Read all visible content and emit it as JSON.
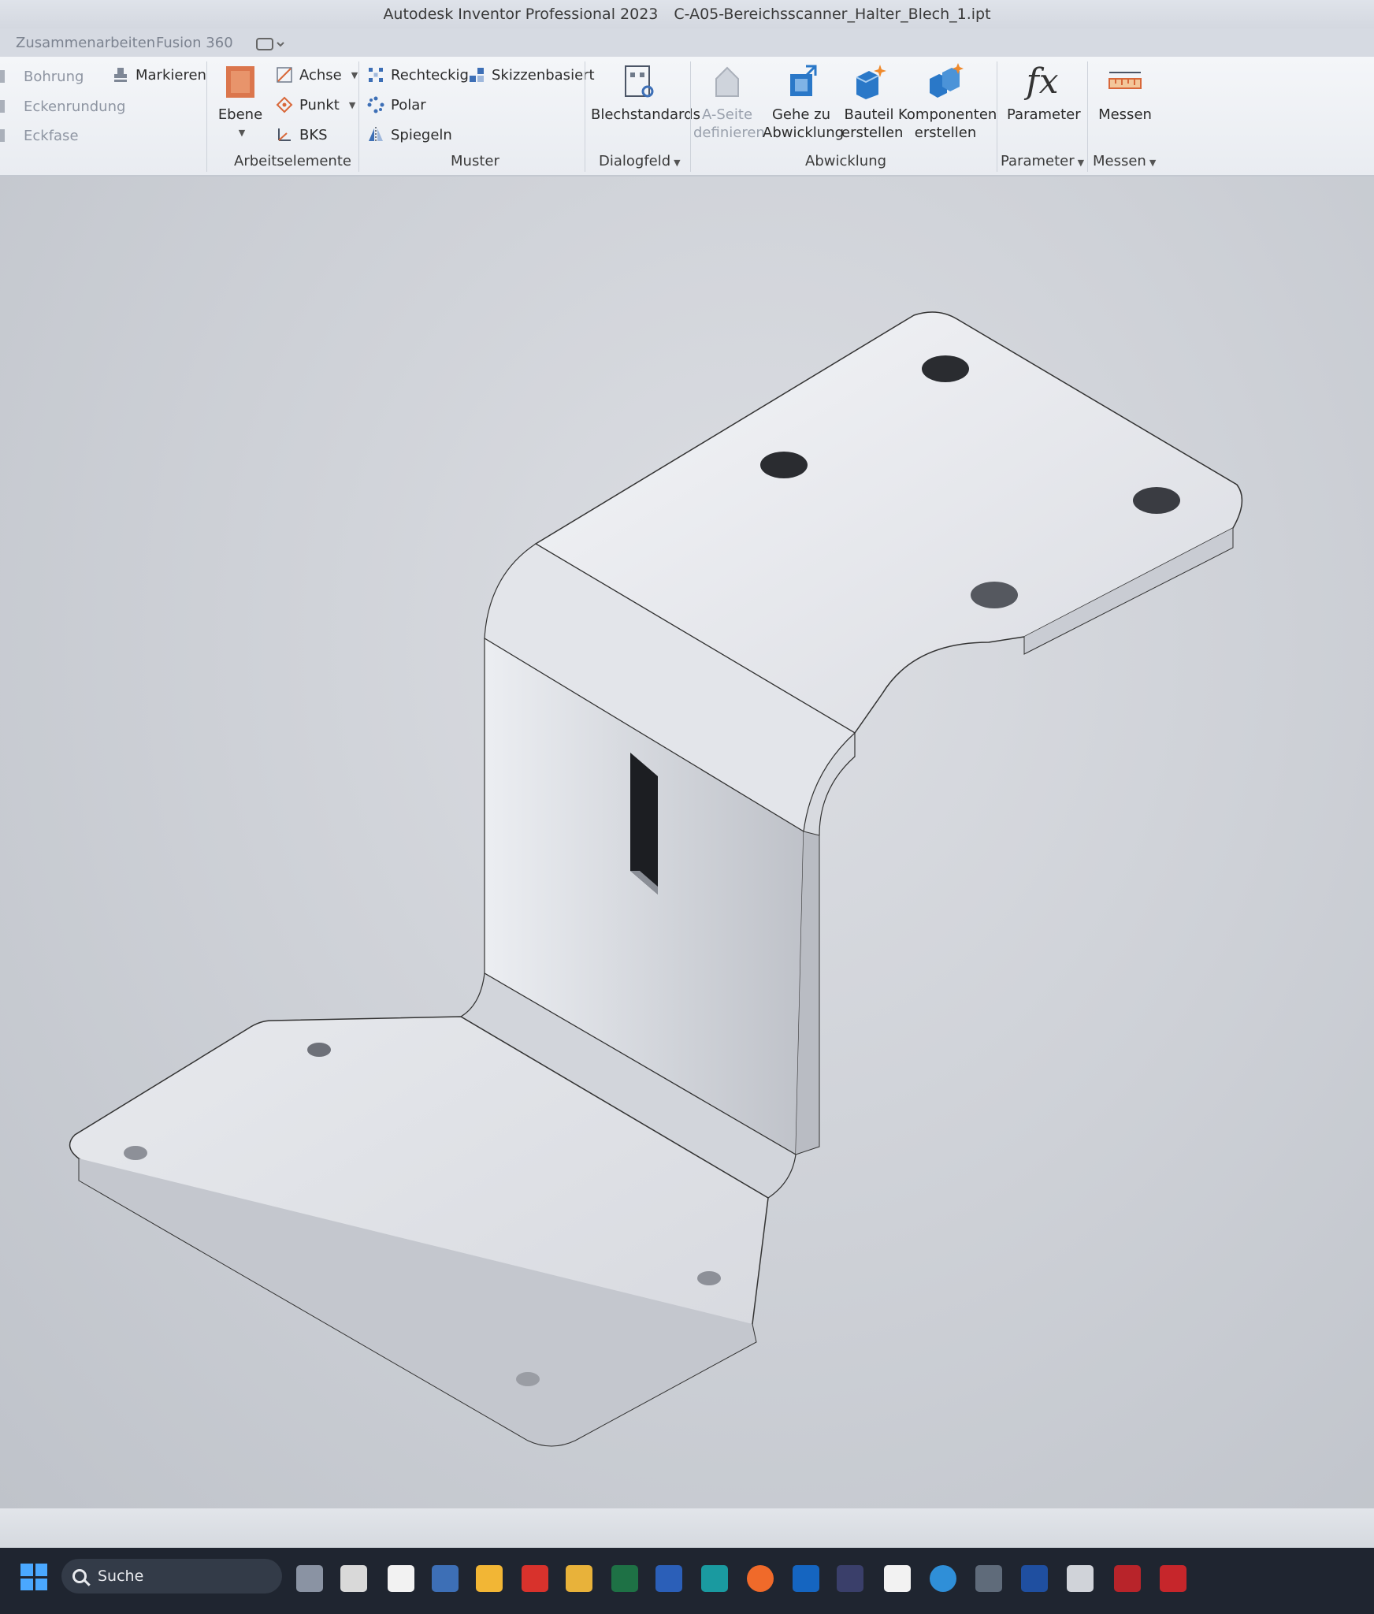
{
  "window": {
    "title_app": "Autodesk Inventor Professional 2023",
    "title_file": "C-A05-Bereichsscanner_Halter_Blech_1.ipt"
  },
  "tabs": [
    {
      "label": "Zusammenarbeiten"
    },
    {
      "label": "Fusion 360"
    }
  ],
  "ribbon": {
    "modify": {
      "bohrung": "Bohrung",
      "eckenrundung": "Eckenrundung",
      "eckfase": "Eckfase",
      "markieren": "Markieren"
    },
    "arbeitselemente": {
      "ebene": "Ebene",
      "achse": "Achse",
      "punkt": "Punkt",
      "bks": "BKS",
      "group": "Arbeitselemente"
    },
    "muster": {
      "rechteckig": "Rechteckig",
      "skizzenbasiert": "Skizzenbasiert",
      "polar": "Polar",
      "spiegeln": "Spiegeln",
      "group": "Muster"
    },
    "dialogfeld": {
      "blechstandards": "Blechstandards",
      "group": "Dialogfeld"
    },
    "abwicklung": {
      "a_seite_1": "A-Seite",
      "a_seite_2": "definieren",
      "gehe_zu_1": "Gehe zu",
      "gehe_zu_2": "Abwicklung",
      "bauteil_1": "Bauteil",
      "bauteil_2": "erstellen",
      "komponenten_1": "Komponenten",
      "komponenten_2": "erstellen",
      "group": "Abwicklung"
    },
    "parameter": {
      "fx": "fx",
      "label": "Parameter",
      "group": "Parameter"
    },
    "messen": {
      "label": "Messen",
      "group": "Messen"
    }
  },
  "taskbar": {
    "search_label": "Suche"
  },
  "colors": {
    "accent_blue": "#2a78c8",
    "ebene_orange": "#d8683a",
    "taskbar_bg": "#1f2530"
  }
}
